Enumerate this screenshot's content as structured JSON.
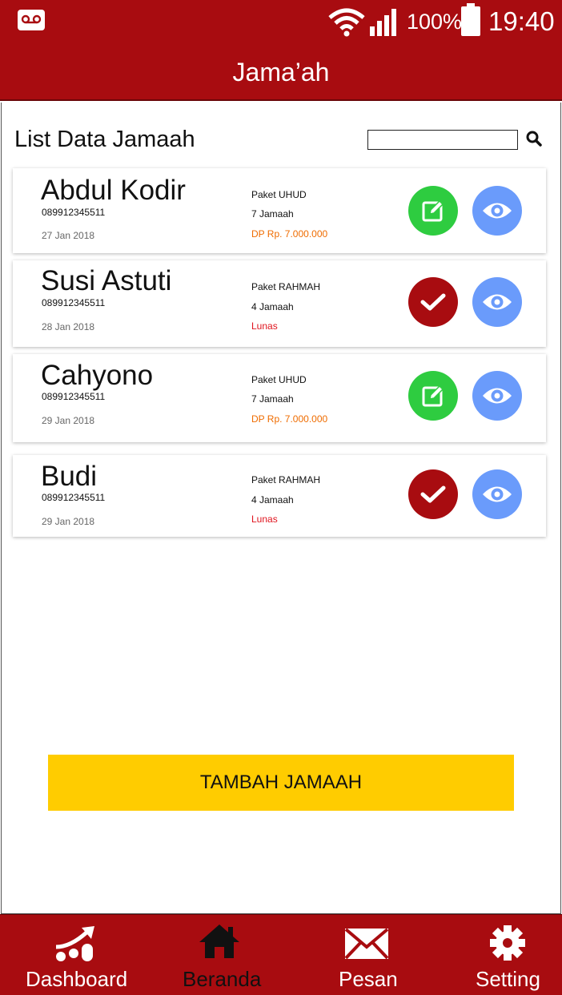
{
  "status_bar": {
    "voicemail_icon": "voicemail-icon",
    "wifi_icon": "wifi-icon",
    "signal_icon": "signal-icon",
    "battery_percent": "100%",
    "battery_icon": "battery-icon",
    "time": "19:40"
  },
  "header": {
    "title": "Jama’ah"
  },
  "list": {
    "heading": "List Data Jamaah",
    "search": {
      "value": "",
      "placeholder": "",
      "icon": "search-icon"
    }
  },
  "colors": {
    "brand_red": "#a80c10",
    "accent_yellow": "#ffcc00",
    "edit_green": "#2ecc40",
    "view_blue": "#6a9bfb",
    "dp_orange": "#ef6c00",
    "lunas_red": "#e0141e"
  },
  "jamaah": [
    {
      "name": "Abdul Kodir",
      "phone": "089912345511",
      "date": "27 Jan 2018",
      "paket": "Paket UHUD",
      "count": "7 Jamaah",
      "status": "DP Rp. 7.000.000",
      "status_type": "dp",
      "action_icon": "edit-icon",
      "view_icon": "eye-icon"
    },
    {
      "name": "Susi Astuti",
      "phone": "089912345511",
      "date": "28 Jan 2018",
      "paket": "Paket RAHMAH",
      "count": "4 Jamaah",
      "status": "Lunas",
      "status_type": "lunas",
      "action_icon": "check-icon",
      "view_icon": "eye-icon"
    },
    {
      "name": "Cahyono",
      "phone": "089912345511",
      "date": "29 Jan 2018",
      "paket": "Paket UHUD",
      "count": "7 Jamaah",
      "status": "DP Rp. 7.000.000",
      "status_type": "dp",
      "action_icon": "edit-icon",
      "view_icon": "eye-icon"
    },
    {
      "name": "Budi",
      "phone": "089912345511",
      "date": "29 Jan 2018",
      "paket": "Paket RAHMAH",
      "count": "4 Jamaah",
      "status": "Lunas",
      "status_type": "lunas",
      "action_icon": "check-icon",
      "view_icon": "eye-icon"
    }
  ],
  "add_button": {
    "label": "TAMBAH JAMAAH"
  },
  "bottom_nav": [
    {
      "label": "Dashboard",
      "icon": "chart-growth-icon",
      "active": false
    },
    {
      "label": "Beranda",
      "icon": "home-icon",
      "active": true
    },
    {
      "label": "Pesan",
      "icon": "envelope-icon",
      "active": false
    },
    {
      "label": "Setting",
      "icon": "gear-icon",
      "active": false
    }
  ]
}
